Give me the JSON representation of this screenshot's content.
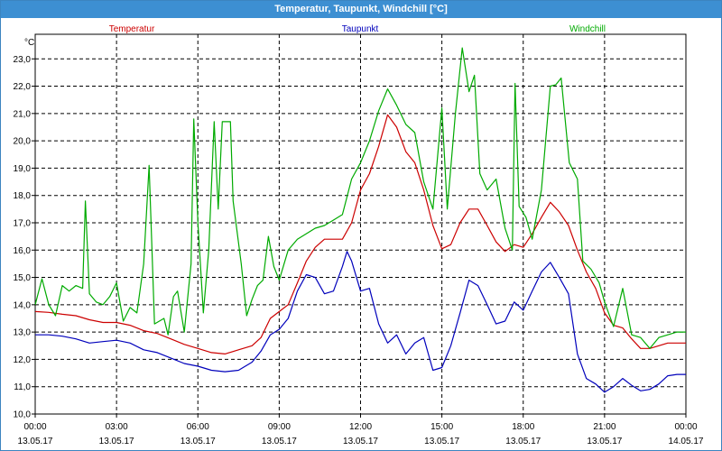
{
  "window": {
    "title": "Temperatur, Taupunkt, Windchill [°C]"
  },
  "chart_data": {
    "type": "line",
    "title": "Temperatur, Taupunkt, Windchill [°C]",
    "unit_label": "°C",
    "ylim": [
      10.0,
      23.9
    ],
    "yticks": [
      10.0,
      11.0,
      12.0,
      13.0,
      14.0,
      15.0,
      16.0,
      17.0,
      18.0,
      19.0,
      20.0,
      21.0,
      22.0,
      23.0
    ],
    "ytick_labels": [
      "10,0",
      "11,0",
      "12,0",
      "13,0",
      "14,0",
      "15,0",
      "16,0",
      "17,0",
      "18,0",
      "19,0",
      "20,0",
      "21,0",
      "22,0",
      "23,0"
    ],
    "xlim": [
      0,
      24
    ],
    "xticks": [
      {
        "h": 0,
        "time": "00:00",
        "date": "13.05.17"
      },
      {
        "h": 3,
        "time": "03:00",
        "date": "13.05.17"
      },
      {
        "h": 6,
        "time": "06:00",
        "date": "13.05.17"
      },
      {
        "h": 9,
        "time": "09:00",
        "date": "13.05.17"
      },
      {
        "h": 12,
        "time": "12:00",
        "date": "13.05.17"
      },
      {
        "h": 15,
        "time": "15:00",
        "date": "13.05.17"
      },
      {
        "h": 18,
        "time": "18:00",
        "date": "13.05.17"
      },
      {
        "h": 21,
        "time": "21:00",
        "date": "13.05.17"
      },
      {
        "h": 24,
        "time": "00:00",
        "date": "14.05.17"
      }
    ],
    "grid": true,
    "legend_placement": "top",
    "series": [
      {
        "name": "Temperatur",
        "color": "#cc0000",
        "points": [
          [
            0,
            13.75
          ],
          [
            0.5,
            13.72
          ],
          [
            1,
            13.65
          ],
          [
            1.5,
            13.6
          ],
          [
            2,
            13.45
          ],
          [
            2.5,
            13.35
          ],
          [
            3,
            13.35
          ],
          [
            3.5,
            13.25
          ],
          [
            4,
            13.05
          ],
          [
            4.5,
            12.95
          ],
          [
            5,
            12.75
          ],
          [
            5.5,
            12.55
          ],
          [
            6,
            12.4
          ],
          [
            6.5,
            12.25
          ],
          [
            7,
            12.2
          ],
          [
            7.5,
            12.35
          ],
          [
            8,
            12.5
          ],
          [
            8.33,
            12.8
          ],
          [
            8.67,
            13.5
          ],
          [
            9,
            13.75
          ],
          [
            9.33,
            14.0
          ],
          [
            9.67,
            14.8
          ],
          [
            10,
            15.6
          ],
          [
            10.33,
            16.1
          ],
          [
            10.67,
            16.4
          ],
          [
            11,
            16.4
          ],
          [
            11.33,
            16.4
          ],
          [
            11.67,
            17.0
          ],
          [
            12,
            18.2
          ],
          [
            12.33,
            18.8
          ],
          [
            12.67,
            19.8
          ],
          [
            13,
            20.95
          ],
          [
            13.33,
            20.5
          ],
          [
            13.67,
            19.6
          ],
          [
            14,
            19.2
          ],
          [
            14.33,
            18.2
          ],
          [
            14.67,
            16.9
          ],
          [
            15,
            16.05
          ],
          [
            15.33,
            16.2
          ],
          [
            15.67,
            17.0
          ],
          [
            16,
            17.5
          ],
          [
            16.33,
            17.5
          ],
          [
            16.67,
            16.9
          ],
          [
            17,
            16.3
          ],
          [
            17.33,
            15.95
          ],
          [
            17.67,
            16.2
          ],
          [
            18,
            16.1
          ],
          [
            18.33,
            16.6
          ],
          [
            18.67,
            17.2
          ],
          [
            19,
            17.75
          ],
          [
            19.33,
            17.4
          ],
          [
            19.67,
            16.9
          ],
          [
            20,
            16.0
          ],
          [
            20.33,
            15.2
          ],
          [
            20.67,
            14.6
          ],
          [
            21,
            13.7
          ],
          [
            21.33,
            13.25
          ],
          [
            21.67,
            13.15
          ],
          [
            22,
            12.75
          ],
          [
            22.33,
            12.4
          ],
          [
            22.67,
            12.4
          ],
          [
            23,
            12.5
          ],
          [
            23.33,
            12.6
          ],
          [
            23.67,
            12.6
          ],
          [
            24,
            12.6
          ]
        ]
      },
      {
        "name": "Taupunkt",
        "color": "#0000bb",
        "points": [
          [
            0,
            12.9
          ],
          [
            0.5,
            12.9
          ],
          [
            1,
            12.85
          ],
          [
            1.5,
            12.75
          ],
          [
            2,
            12.6
          ],
          [
            2.5,
            12.65
          ],
          [
            3,
            12.7
          ],
          [
            3.5,
            12.6
          ],
          [
            4,
            12.35
          ],
          [
            4.5,
            12.25
          ],
          [
            5,
            12.05
          ],
          [
            5.5,
            11.85
          ],
          [
            6,
            11.75
          ],
          [
            6.5,
            11.6
          ],
          [
            7,
            11.55
          ],
          [
            7.5,
            11.6
          ],
          [
            8,
            11.9
          ],
          [
            8.33,
            12.3
          ],
          [
            8.67,
            12.9
          ],
          [
            9,
            13.1
          ],
          [
            9.33,
            13.5
          ],
          [
            9.67,
            14.5
          ],
          [
            10,
            15.1
          ],
          [
            10.33,
            15.0
          ],
          [
            10.67,
            14.4
          ],
          [
            11,
            14.5
          ],
          [
            11.33,
            15.4
          ],
          [
            11.5,
            15.95
          ],
          [
            11.67,
            15.6
          ],
          [
            12,
            14.5
          ],
          [
            12.33,
            14.6
          ],
          [
            12.67,
            13.3
          ],
          [
            13,
            12.6
          ],
          [
            13.33,
            12.9
          ],
          [
            13.67,
            12.2
          ],
          [
            14,
            12.6
          ],
          [
            14.33,
            12.8
          ],
          [
            14.67,
            11.6
          ],
          [
            15,
            11.7
          ],
          [
            15.33,
            12.5
          ],
          [
            15.67,
            13.7
          ],
          [
            16,
            14.9
          ],
          [
            16.33,
            14.7
          ],
          [
            16.67,
            14.0
          ],
          [
            17,
            13.3
          ],
          [
            17.33,
            13.4
          ],
          [
            17.67,
            14.1
          ],
          [
            18,
            13.8
          ],
          [
            18.33,
            14.5
          ],
          [
            18.67,
            15.2
          ],
          [
            19,
            15.55
          ],
          [
            19.33,
            15.0
          ],
          [
            19.67,
            14.4
          ],
          [
            20,
            12.2
          ],
          [
            20.33,
            11.3
          ],
          [
            20.67,
            11.1
          ],
          [
            21,
            10.8
          ],
          [
            21.33,
            11.0
          ],
          [
            21.67,
            11.3
          ],
          [
            22,
            11.05
          ],
          [
            22.33,
            10.85
          ],
          [
            22.67,
            10.9
          ],
          [
            23,
            11.1
          ],
          [
            23.33,
            11.4
          ],
          [
            23.67,
            11.45
          ],
          [
            24,
            11.45
          ]
        ]
      },
      {
        "name": "Windchill",
        "color": "#00aa00",
        "points": [
          [
            0,
            14.0
          ],
          [
            0.25,
            14.95
          ],
          [
            0.5,
            14.0
          ],
          [
            0.75,
            13.6
          ],
          [
            1,
            14.7
          ],
          [
            1.25,
            14.5
          ],
          [
            1.5,
            14.7
          ],
          [
            1.75,
            14.6
          ],
          [
            1.85,
            17.8
          ],
          [
            2,
            14.4
          ],
          [
            2.25,
            14.1
          ],
          [
            2.5,
            14.0
          ],
          [
            2.75,
            14.3
          ],
          [
            3,
            14.8
          ],
          [
            3.25,
            13.4
          ],
          [
            3.5,
            13.9
          ],
          [
            3.75,
            13.7
          ],
          [
            4,
            15.5
          ],
          [
            4.2,
            19.1
          ],
          [
            4.4,
            13.3
          ],
          [
            4.75,
            13.5
          ],
          [
            4.9,
            12.9
          ],
          [
            5.1,
            14.3
          ],
          [
            5.25,
            14.5
          ],
          [
            5.5,
            13.0
          ],
          [
            5.75,
            15.5
          ],
          [
            5.85,
            20.8
          ],
          [
            6,
            17.0
          ],
          [
            6.2,
            13.7
          ],
          [
            6.4,
            16.0
          ],
          [
            6.6,
            20.7
          ],
          [
            6.75,
            17.5
          ],
          [
            6.9,
            20.7
          ],
          [
            7.2,
            20.7
          ],
          [
            7.3,
            17.8
          ],
          [
            7.6,
            15.5
          ],
          [
            7.8,
            13.6
          ],
          [
            8,
            14.2
          ],
          [
            8.2,
            14.7
          ],
          [
            8.4,
            14.9
          ],
          [
            8.6,
            16.5
          ],
          [
            8.8,
            15.4
          ],
          [
            9,
            14.9
          ],
          [
            9.33,
            16.0
          ],
          [
            9.67,
            16.4
          ],
          [
            10,
            16.6
          ],
          [
            10.33,
            16.8
          ],
          [
            10.67,
            16.9
          ],
          [
            11,
            17.1
          ],
          [
            11.33,
            17.3
          ],
          [
            11.67,
            18.6
          ],
          [
            12,
            19.2
          ],
          [
            12.33,
            20.0
          ],
          [
            12.67,
            21.1
          ],
          [
            13,
            21.9
          ],
          [
            13.33,
            21.3
          ],
          [
            13.67,
            20.6
          ],
          [
            14,
            20.3
          ],
          [
            14.33,
            18.5
          ],
          [
            14.67,
            17.5
          ],
          [
            15,
            21.2
          ],
          [
            15.2,
            17.5
          ],
          [
            15.5,
            21.0
          ],
          [
            15.75,
            23.4
          ],
          [
            16,
            21.8
          ],
          [
            16.2,
            22.4
          ],
          [
            16.4,
            18.8
          ],
          [
            16.67,
            18.2
          ],
          [
            17,
            18.6
          ],
          [
            17.33,
            16.8
          ],
          [
            17.6,
            16.0
          ],
          [
            17.7,
            22.1
          ],
          [
            17.85,
            17.6
          ],
          [
            18.1,
            17.2
          ],
          [
            18.33,
            16.4
          ],
          [
            18.67,
            18.2
          ],
          [
            19,
            22.0
          ],
          [
            19.2,
            22.05
          ],
          [
            19.4,
            22.3
          ],
          [
            19.7,
            19.2
          ],
          [
            20,
            18.6
          ],
          [
            20.2,
            15.6
          ],
          [
            20.5,
            15.3
          ],
          [
            20.8,
            14.8
          ],
          [
            21,
            14.1
          ],
          [
            21.33,
            13.2
          ],
          [
            21.67,
            14.6
          ],
          [
            22,
            12.9
          ],
          [
            22.33,
            12.8
          ],
          [
            22.67,
            12.4
          ],
          [
            23,
            12.8
          ],
          [
            23.33,
            12.9
          ],
          [
            23.67,
            13.0
          ],
          [
            24,
            13.0
          ]
        ]
      }
    ]
  }
}
